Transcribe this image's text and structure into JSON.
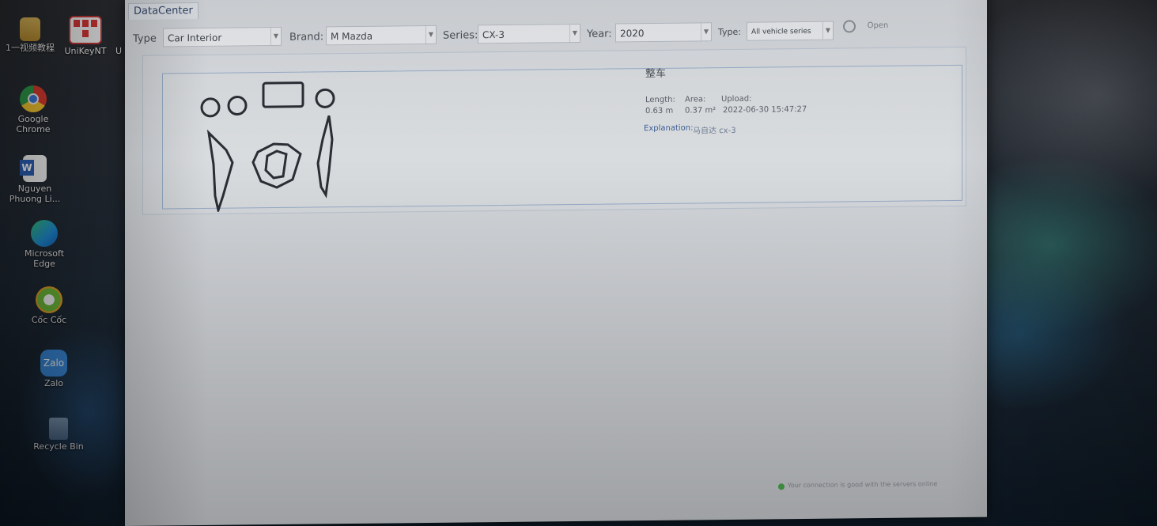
{
  "desktop": {
    "icons": [
      {
        "label": "1一视频教程",
        "icon": "folder-icon"
      },
      {
        "label": "UniKeyNT",
        "icon": "unikey-icon"
      },
      {
        "label": "Google Chrome",
        "label1": "Google",
        "label2": "Chrome",
        "icon": "chrome-icon"
      },
      {
        "label1": "Nguyen",
        "label2": "Phuong Li...",
        "icon": "word-document-icon"
      },
      {
        "label1": "Microsoft",
        "label2": "Edge",
        "icon": "edge-icon"
      },
      {
        "label": "Cốc Cốc",
        "icon": "coccoc-icon"
      },
      {
        "label": "Zalo",
        "icon": "zalo-icon"
      },
      {
        "label": "Recycle Bin",
        "icon": "recycle-bin-icon"
      }
    ],
    "partial_label": "U"
  },
  "window": {
    "tab": "DataCenter",
    "toolbar": {
      "type_label": "Type",
      "type_value": "Car Interior",
      "brand_label": "Brand:",
      "brand_value": "M Mazda",
      "series_label": "Series:",
      "series_value": "CX-3",
      "year_label": "Year:",
      "year_value": "2020",
      "type2_label": "Type:",
      "type2_value": "All vehicle series",
      "open_label": "Open"
    },
    "result": {
      "title": "整车",
      "length_label": "Length:",
      "length_value": "0.63 m",
      "area_label": "Area:",
      "area_value": "0.37 m²",
      "upload_label": "Upload:",
      "upload_value": "2022-06-30 15:47:27",
      "explanation_label": "Explanation:",
      "explanation_value": "马自达 cx-3"
    },
    "status": "Your connection is good with the servers online"
  },
  "colors": {
    "window_bg": "#d3d6da",
    "card_border": "#98acc8",
    "tab_text": "#33466a",
    "explanation_label": "#3d5f95"
  }
}
